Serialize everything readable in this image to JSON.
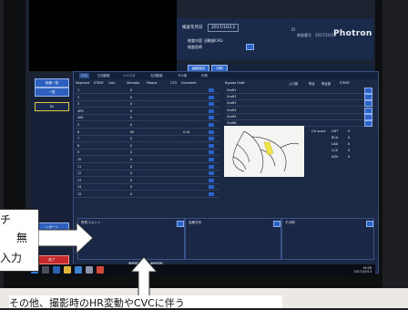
{
  "header": {
    "exam_date_label": "検査年月日",
    "exam_date": "2017/10/13",
    "patient_label": "検査内容",
    "patient_value": "冠動脈CAG",
    "physician_label": "検査医師",
    "physician_value": "",
    "meta_1": "ID",
    "meta_2": "検査番号",
    "meta_3": "2017/10/13",
    "brand": "Photron"
  },
  "action_bar": {
    "buttons": [
      "画面保存",
      "印刷"
    ]
  },
  "sidebar": {
    "buttons": [
      "検査一覧",
      "一覧",
      "ID",
      "",
      "",
      "",
      "",
      "レポート",
      "",
      "終了"
    ]
  },
  "tabs": [
    "CAG",
    "左冠動脈",
    "バイパス",
    "右冠動脈",
    "その他",
    "計測"
  ],
  "grid": {
    "headers": [
      "Segment",
      "STENT",
      "Calc.",
      "Stenosis",
      "Plaque",
      "CTO",
      "Comment"
    ],
    "rows": [
      [
        "1",
        "",
        "",
        "0",
        "",
        "",
        ""
      ],
      [
        "2",
        "",
        "",
        "0",
        "",
        "",
        ""
      ],
      [
        "3",
        "",
        "",
        "0",
        "",
        "",
        ""
      ],
      [
        "4PD",
        "",
        "",
        "0",
        "",
        "",
        ""
      ],
      [
        "4AV",
        "",
        "",
        "0",
        "",
        "",
        ""
      ],
      [
        "5",
        "",
        "",
        "0",
        "",
        "",
        ""
      ],
      [
        "6",
        "",
        "",
        "90",
        "",
        "",
        "0.18"
      ],
      [
        "7",
        "",
        "",
        "0",
        "",
        "",
        ""
      ],
      [
        "8",
        "",
        "",
        "0",
        "",
        "",
        ""
      ],
      [
        "9",
        "",
        "",
        "0",
        "",
        "",
        ""
      ],
      [
        "10",
        "",
        "",
        "0",
        "",
        "",
        ""
      ],
      [
        "11",
        "",
        "",
        "0",
        "",
        "",
        ""
      ],
      [
        "12",
        "",
        "",
        "0",
        "",
        "",
        ""
      ],
      [
        "13",
        "",
        "",
        "0",
        "",
        "",
        ""
      ],
      [
        "14",
        "",
        "",
        "0",
        "",
        "",
        ""
      ],
      [
        "15",
        "",
        "",
        "0",
        "",
        "",
        ""
      ]
    ]
  },
  "graft": {
    "headers": [
      "Bypass Graft",
      "入口部",
      "吻合",
      "吻合部",
      "STENT"
    ],
    "rows": [
      "Graft1",
      "Graft2",
      "Graft3",
      "Graft4",
      "Graft5",
      "Graft6"
    ]
  },
  "ca_score": {
    "label": "CA score",
    "rows": [
      [
        "LMT",
        "0"
      ],
      [
        "RCA",
        "0"
      ],
      [
        "LAD",
        "0"
      ],
      [
        "LCX",
        "0"
      ],
      [
        "AGS",
        "0"
      ]
    ]
  },
  "comments": [
    {
      "label": "所見コメント"
    },
    {
      "label": "治療方針"
    },
    {
      "label": "その他"
    }
  ],
  "bottom_buttons": [
    "画面保存",
    "画面印刷"
  ],
  "taskbar": {
    "time": "16:08",
    "date": "2017/10/13"
  },
  "callouts": {
    "left_lines": [
      "チ",
      "無",
      "入力"
    ],
    "bottom": "その他、撮影時のHR変動やCVCに伴う"
  },
  "colors": {
    "panel_blue": "#1a2a4a",
    "button_blue": "#2c63c8",
    "highlight_yellow": "#e1cc3a",
    "end_red": "#c42a2a"
  }
}
